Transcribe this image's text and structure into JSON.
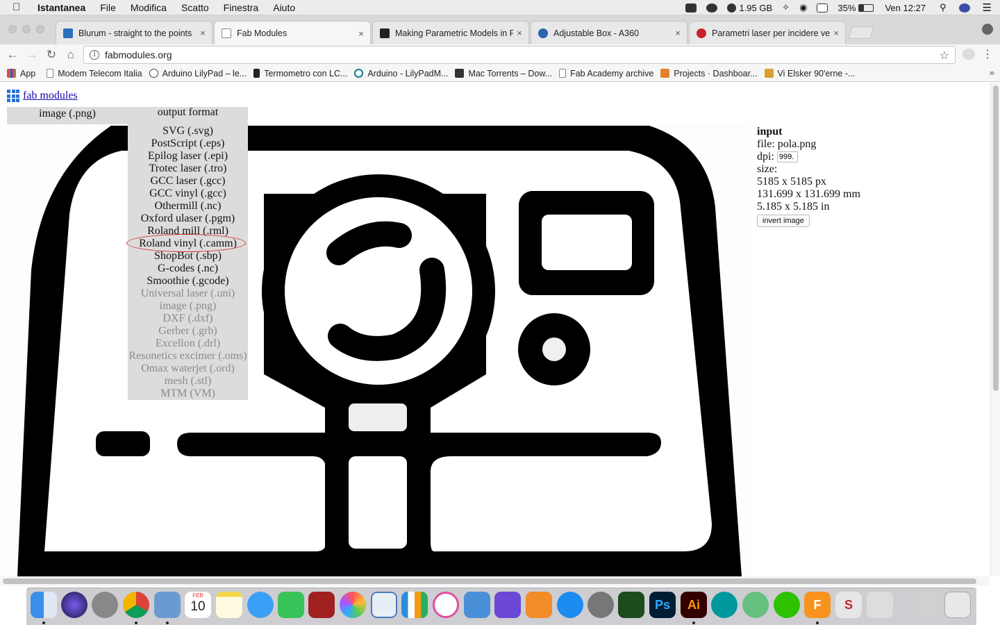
{
  "menubar": {
    "app_name": "Istantanea",
    "items": [
      "File",
      "Modifica",
      "Scatto",
      "Finestra",
      "Aiuto"
    ],
    "disk": "1.95 GB",
    "battery": "35%",
    "clock": "Ven 12:27"
  },
  "tabs": [
    {
      "title": "Blurum - straight to the points",
      "close": "×"
    },
    {
      "title": "Fab Modules",
      "close": "×"
    },
    {
      "title": "Making Parametric Models in F",
      "close": "×"
    },
    {
      "title": "Adjustable Box - A360",
      "close": "×"
    },
    {
      "title": "Parametri laser per incidere ve",
      "close": "×"
    }
  ],
  "toolbar": {
    "url": "fabmodules.org"
  },
  "bookmarks": [
    "App",
    "Modem Telecom Italia",
    "Arduino LilyPad – le...",
    "Termometro con LC...",
    "Arduino - LilyPadM...",
    "Mac Torrents – Dow...",
    "Fab Academy archive",
    "Projects · Dashboar...",
    "Vi Elsker 90'erne -..."
  ],
  "page": {
    "logo_text": "fab modules",
    "input_format": "image (.png)",
    "output_format": "output format",
    "output_options": [
      {
        "label": "SVG (.svg)",
        "enabled": true
      },
      {
        "label": "PostScript (.eps)",
        "enabled": true
      },
      {
        "label": "Epilog laser (.epi)",
        "enabled": true
      },
      {
        "label": "Trotec laser (.tro)",
        "enabled": true
      },
      {
        "label": "GCC laser (.gcc)",
        "enabled": true
      },
      {
        "label": "GCC vinyl (.gcc)",
        "enabled": true
      },
      {
        "label": "Othermill (.nc)",
        "enabled": true
      },
      {
        "label": "Oxford ulaser (.pgm)",
        "enabled": true
      },
      {
        "label": "Roland mill (.rml)",
        "enabled": true
      },
      {
        "label": "Roland vinyl (.camm)",
        "enabled": true,
        "highlighted": true
      },
      {
        "label": "ShopBot (.sbp)",
        "enabled": true
      },
      {
        "label": "G-codes (.nc)",
        "enabled": true
      },
      {
        "label": "Smoothie (.gcode)",
        "enabled": true
      },
      {
        "label": "Universal laser (.uni)",
        "enabled": false
      },
      {
        "label": "image (.png)",
        "enabled": false
      },
      {
        "label": "DXF (.dxf)",
        "enabled": false
      },
      {
        "label": "Gerber (.grb)",
        "enabled": false
      },
      {
        "label": "Excellon (.drl)",
        "enabled": false
      },
      {
        "label": "Resonetics excimer (.oms)",
        "enabled": false
      },
      {
        "label": "Omax waterjet (.ord)",
        "enabled": false
      },
      {
        "label": "mesh (.stl)",
        "enabled": false
      },
      {
        "label": "MTM (VM)",
        "enabled": false
      }
    ],
    "info": {
      "heading": "input",
      "file": "file: pola.png",
      "dpi_label": "dpi:",
      "dpi_value": "999.",
      "size_label": "size:",
      "size_px": "5185 x 5185 px",
      "size_mm": "131.699 x 131.699 mm",
      "size_in": "5.185 x 5.185 in",
      "invert_button": "invert image"
    }
  },
  "dock": {
    "apps": [
      "finder-icon",
      "siri-icon",
      "launchpad-icon",
      "chrome-icon",
      "preview-icon",
      "calendar-icon",
      "notes-icon",
      "messages-icon",
      "facetime-icon",
      "photo-booth-icon",
      "photos-icon",
      "keynote-doc-icon",
      "numbers-icon",
      "itunes-icon",
      "keynote-icon",
      "imovie-icon",
      "ibooks-icon",
      "app-store-icon",
      "system-preferences-icon",
      "grapher-icon",
      "photoshop-icon",
      "illustrator-icon",
      "arduino-icon",
      "atom-icon",
      "wechat-icon",
      "fusion360-icon",
      "sketchup-icon",
      "inkscape-icon",
      "downloads-icon",
      "trash-icon"
    ],
    "calendar_day": "10",
    "calendar_month": "FEB",
    "photoshop_label": "Ps",
    "illustrator_label": "Ai",
    "fusion_label": "F",
    "sketch_label": "S"
  },
  "colors": {
    "link": "#1a0dab",
    "highlight_circle": "#d63030",
    "menu_bg": "#dcdcdc",
    "disabled_text": "#8a8a8a"
  }
}
